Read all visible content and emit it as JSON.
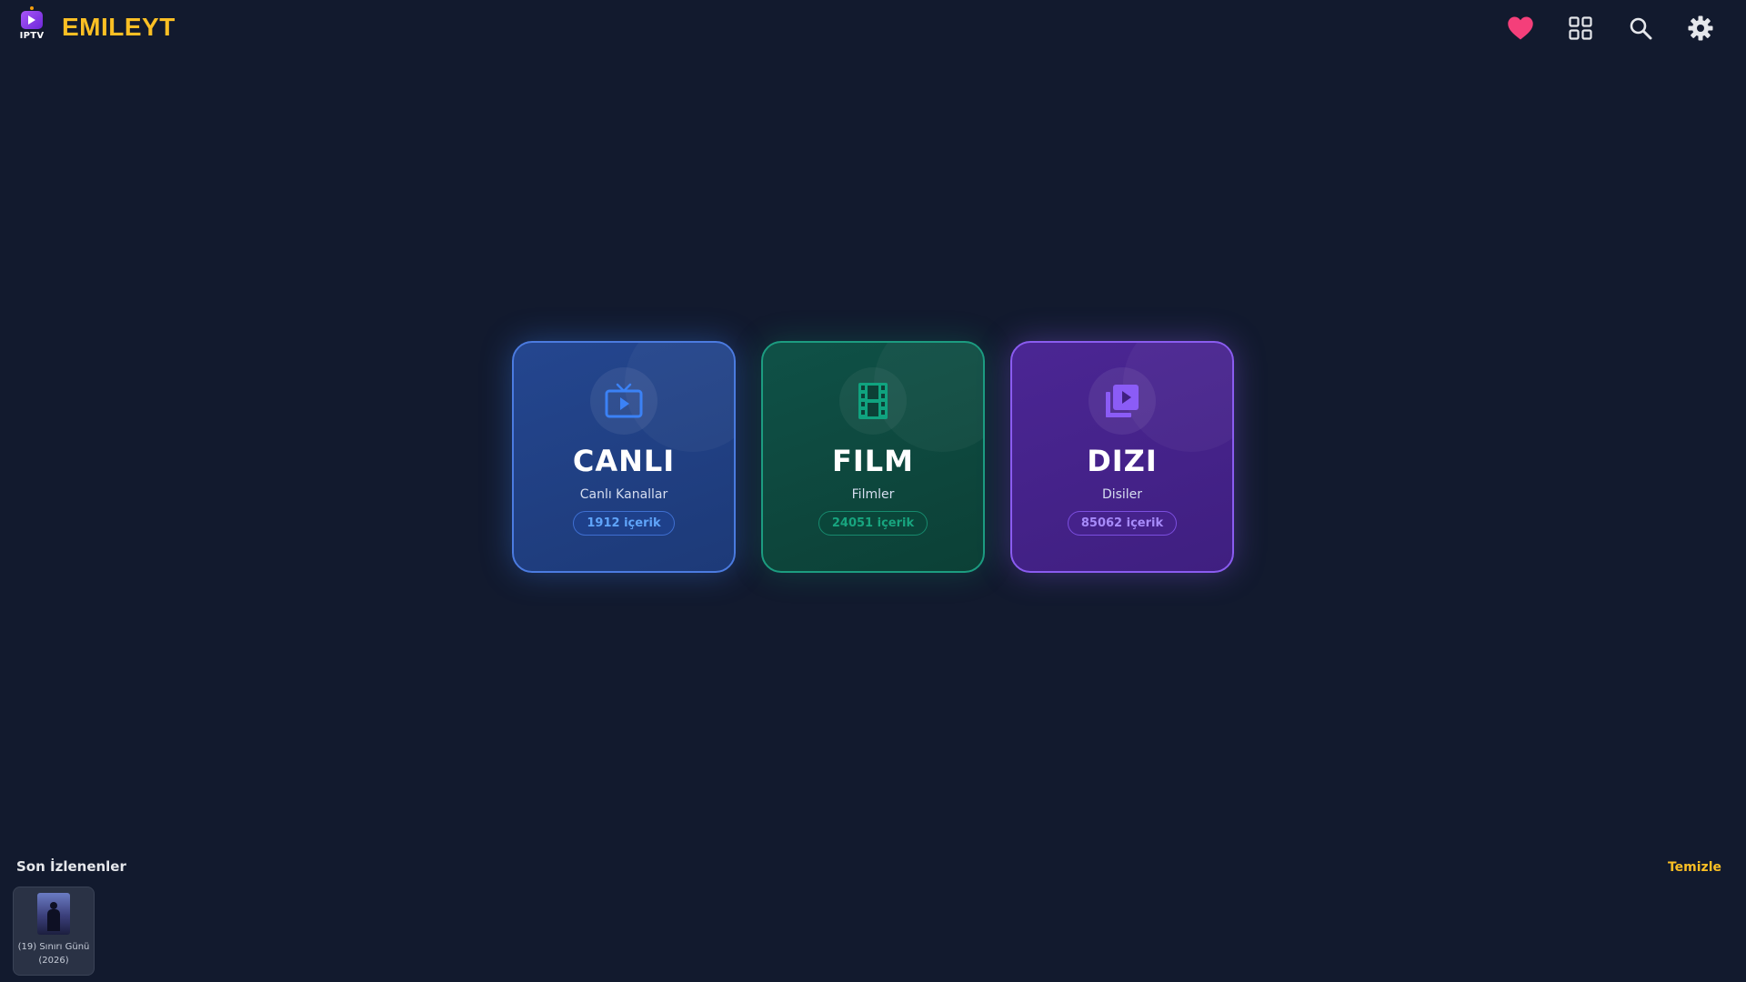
{
  "app": {
    "logo_text": "IPTV",
    "brand": "EMILEYT"
  },
  "header": {
    "actions": [
      {
        "name": "favorites",
        "icon": "heart-icon",
        "color": "#f43f7a"
      },
      {
        "name": "grid-view",
        "icon": "grid-icon",
        "color": "#e5e7eb"
      },
      {
        "name": "search",
        "icon": "search-icon",
        "color": "#e5e7eb"
      },
      {
        "name": "settings",
        "icon": "gear-icon",
        "color": "#e5e7eb"
      }
    ]
  },
  "categories": [
    {
      "title": "CANLI",
      "subtitle": "Canlı Kanallar",
      "count": "1912 içerik",
      "icon": "tv-icon",
      "accent": "#3b82f6"
    },
    {
      "title": "FILM",
      "subtitle": "Filmler",
      "count": "24051 içerik",
      "icon": "film-icon",
      "accent": "#10b981"
    },
    {
      "title": "DIZI",
      "subtitle": "Disiler",
      "count": "85062 içerik",
      "icon": "series-icon",
      "accent": "#8b5cf6"
    }
  ],
  "recent": {
    "title": "Son İzlenenler",
    "clear_label": "Temizle",
    "items": [
      {
        "label": "(19) Sınırı Günü (2026)"
      }
    ]
  }
}
